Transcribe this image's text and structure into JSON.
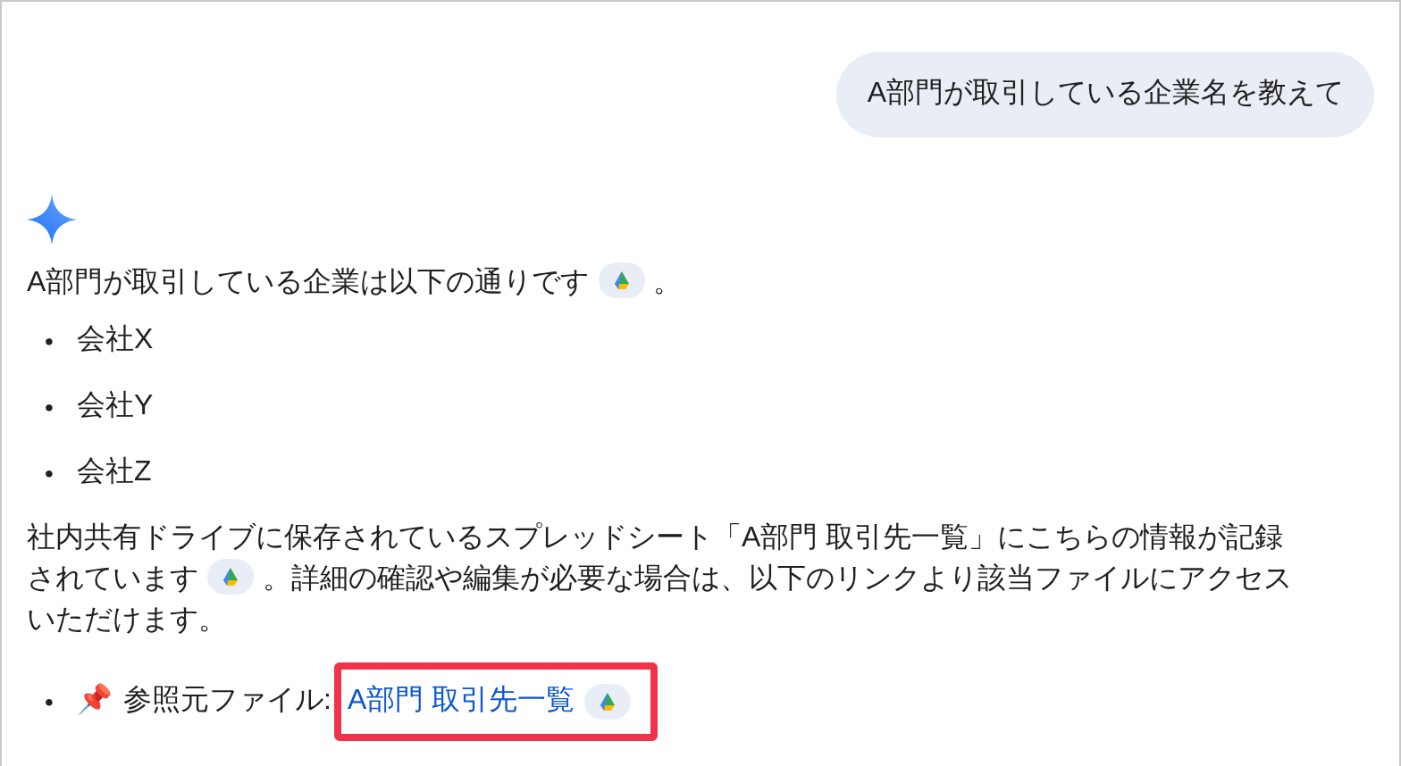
{
  "user_message": "A部門が取引している企業名を教えて",
  "answer": {
    "intro": [
      {
        "kind": "text",
        "text": "A部門が取引している企業は以下の通りです"
      },
      {
        "kind": "source_chip"
      },
      {
        "kind": "text",
        "text": "。"
      }
    ],
    "companies": [
      {
        "bullet": "•",
        "text": "会社X"
      },
      {
        "bullet": "•",
        "text": "会社Y"
      },
      {
        "bullet": "•",
        "text": "会社Z"
      }
    ],
    "paragraph_lines": [
      [
        {
          "kind": "text",
          "text": "社内共有ドライブに保存されているスプレッドシート「A部門 取引先一覧」にこちらの情報が記録"
        }
      ],
      [
        {
          "kind": "text",
          "text": "されています"
        },
        {
          "kind": "source_chip"
        },
        {
          "kind": "text",
          "text": "。詳細の確認や編集が必要な場合は、以下のリンクより該当ファイルにアクセス"
        }
      ],
      [
        {
          "kind": "text",
          "text": "いただけます。"
        }
      ]
    ],
    "reference": {
      "bullet": "•",
      "emoji": "📌",
      "label": "参照元ファイル:",
      "link": "A部門 取引先一覧",
      "highlighted": true
    }
  }
}
